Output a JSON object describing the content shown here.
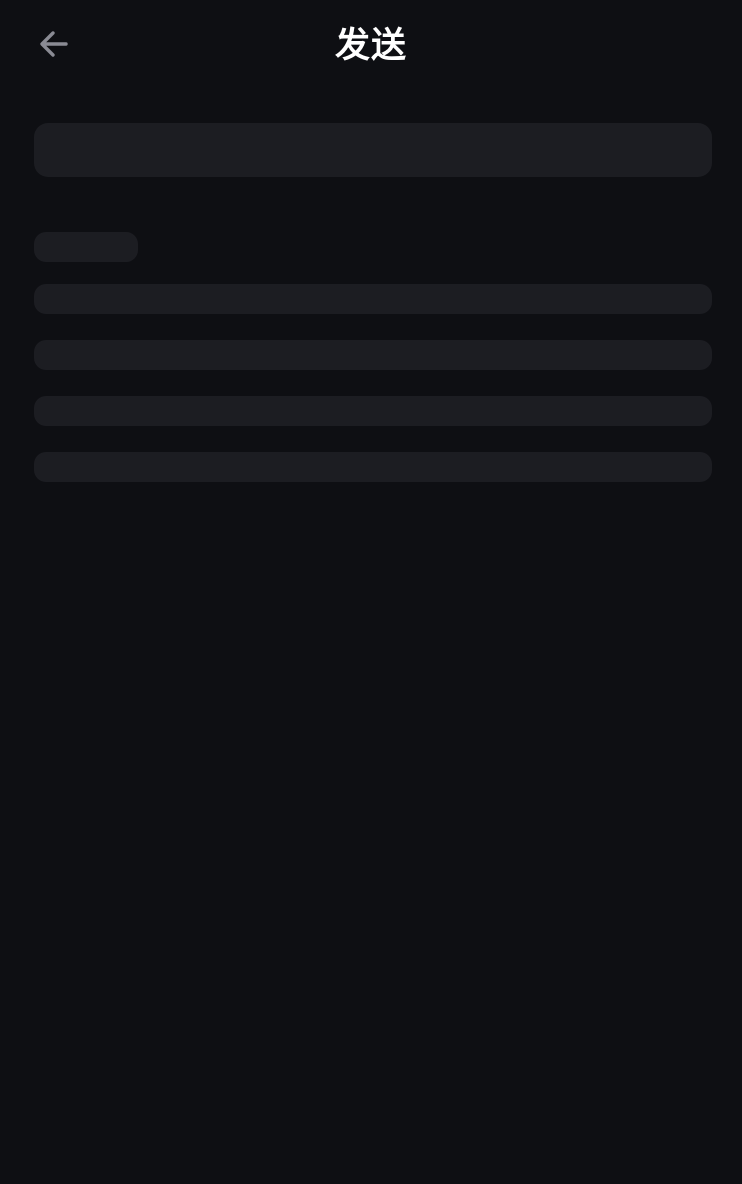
{
  "header": {
    "title": "发送",
    "back_icon": "arrow-left-icon"
  },
  "theme": {
    "background": "#0e0f13",
    "skeleton": "#1c1d22",
    "title_color": "#ffffff",
    "icon_color": "#8a8b94"
  },
  "loading_state": {
    "skeleton_lines": 4
  }
}
